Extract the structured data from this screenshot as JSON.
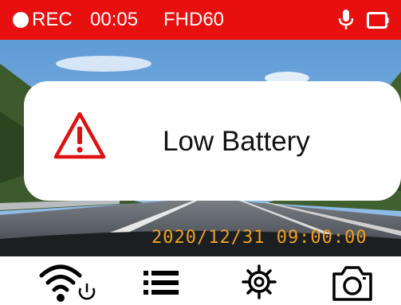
{
  "status_bar": {
    "rec_label": "REC",
    "timer": "00:05",
    "resolution": "FHD60",
    "background_color": "#e8100e"
  },
  "alert": {
    "message": "Low Battery",
    "icon": "warning-triangle-icon",
    "icon_color": "#e01010"
  },
  "overlay": {
    "timestamp": "2020/12/31 09:00:00",
    "timestamp_color": "#f0a020"
  },
  "toolbar": {
    "items": [
      {
        "icon": "wifi-power-icon"
      },
      {
        "icon": "menu-list-icon"
      },
      {
        "icon": "settings-gear-icon"
      },
      {
        "icon": "camera-icon"
      }
    ]
  }
}
